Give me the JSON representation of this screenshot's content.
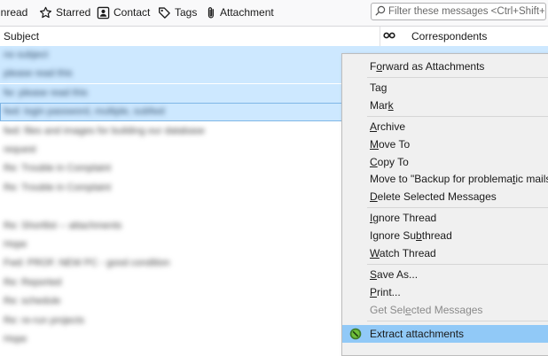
{
  "toolbar": {
    "unread": "Unread",
    "starred": "Starred",
    "contact": "Contact",
    "tags": "Tags",
    "attachment": "Attachment",
    "filter_placeholder": "Filter these messages <Ctrl+Shift+K>"
  },
  "columns": {
    "subject": "Subject",
    "correspondents": "Correspondents"
  },
  "rows": [
    {
      "text": "no subject",
      "selected": true
    },
    {
      "text": "please read this",
      "selected": true
    },
    {
      "text": "fw: please read this",
      "selected": true
    },
    {
      "text": "fwd: login password, multiple, subfwd",
      "selected": true,
      "focused": true
    },
    {
      "text": "fwd: files and images for building our database",
      "selected": false
    },
    {
      "text": "request",
      "selected": false
    },
    {
      "text": "Re: Trouble in Complaint",
      "selected": false
    },
    {
      "text": "Re: Trouble in Complaint",
      "selected": false
    },
    {
      "text": "",
      "selected": false
    },
    {
      "text": "Re: Shortlist -- attachments",
      "selected": false
    },
    {
      "text": "Hope",
      "selected": false
    },
    {
      "text": "Fwd: PROF. NEW PC - good condition",
      "selected": false
    },
    {
      "text": "Re: Reported",
      "selected": false
    },
    {
      "text": "Re: schedule",
      "selected": false
    },
    {
      "text": "Re: re-run projects",
      "selected": false
    },
    {
      "text": "Hope",
      "selected": false
    }
  ],
  "menu": {
    "forward_attachments": {
      "pre": "F",
      "u": "o",
      "post": "rward as Attachments"
    },
    "tag": {
      "pre": "Ta",
      "u": "g",
      "post": ""
    },
    "mark": {
      "pre": "Mar",
      "u": "k",
      "post": ""
    },
    "archive": {
      "pre": "",
      "u": "A",
      "post": "rchive"
    },
    "move_to": {
      "pre": "",
      "u": "M",
      "post": "ove To"
    },
    "copy_to": {
      "pre": "",
      "u": "C",
      "post": "opy To"
    },
    "move_backup": {
      "pre": "Move to \"Backup for problema",
      "u": "t",
      "post": "ic mails\" A"
    },
    "delete": {
      "pre": "",
      "u": "D",
      "post": "elete Selected Messages"
    },
    "ignore_thread": {
      "pre": "",
      "u": "I",
      "post": "gnore Thread"
    },
    "ignore_subthread": {
      "pre": "Ignore Su",
      "u": "b",
      "post": "thread"
    },
    "watch_thread": {
      "pre": "",
      "u": "W",
      "post": "atch Thread"
    },
    "save_as": {
      "pre": "",
      "u": "S",
      "post": "ave As..."
    },
    "print": {
      "pre": "",
      "u": "P",
      "post": "rint..."
    },
    "get_selected": {
      "pre": "Get Sel",
      "u": "e",
      "post": "cted Messages"
    },
    "extract": {
      "pre": "",
      "u": "",
      "post": "Extract attachments"
    }
  },
  "colors": {
    "selection": "#cde8ff",
    "menu_highlight": "#91c9f7",
    "menu_bg": "#f0f0f0"
  }
}
